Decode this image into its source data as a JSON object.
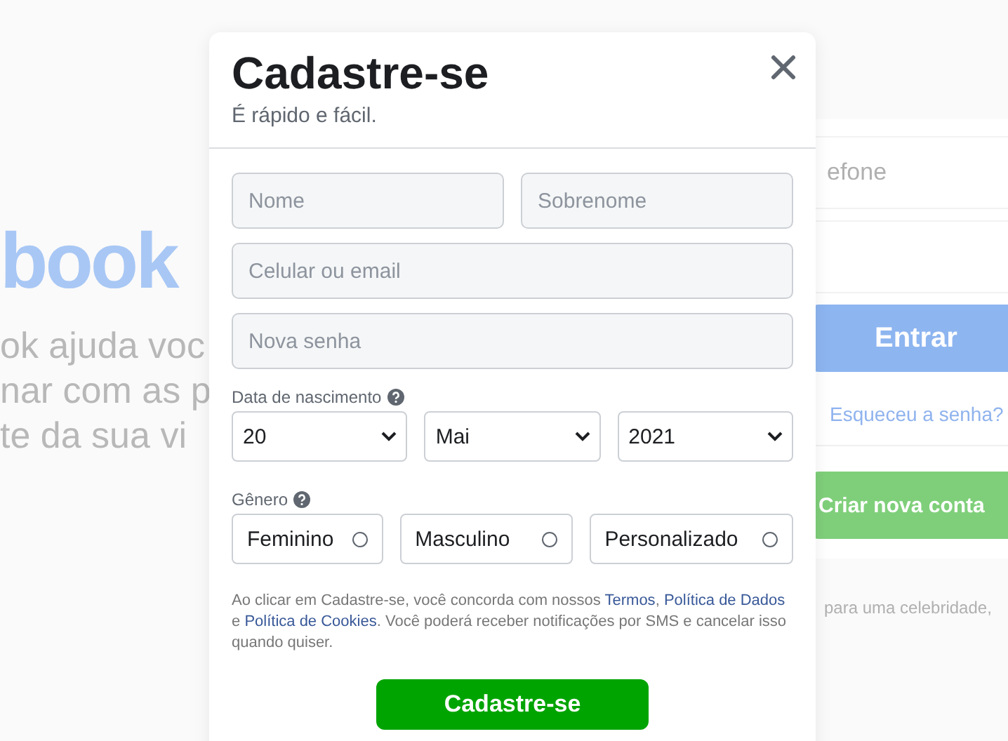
{
  "background": {
    "logo": "book",
    "tagline": [
      "ok ajuda voc",
      "nar com as p",
      "te da sua vi"
    ],
    "login": {
      "phone_placeholder": "efone",
      "login_button": "Entrar",
      "forgot_link": "Esqueceu a senha?",
      "create_button": "Criar nova conta",
      "footer": "para uma celebridade,"
    }
  },
  "dialog": {
    "title": "Cadastre-se",
    "subtitle": "É rápido e fácil.",
    "name_fields": [
      {
        "placeholder": "Nome"
      },
      {
        "placeholder": "Sobrenome"
      }
    ],
    "contact_field": {
      "placeholder": "Celular ou email"
    },
    "password_field": {
      "placeholder": "Nova senha"
    },
    "birth_label": "Data de nascimento",
    "birth_selects": [
      {
        "value": "20"
      },
      {
        "value": "Mai"
      },
      {
        "value": "2021"
      }
    ],
    "gender_label": "Gênero",
    "genders": [
      {
        "label": "Feminino",
        "selected": false
      },
      {
        "label": "Masculino",
        "selected": false
      },
      {
        "label": "Personalizado",
        "selected": false
      }
    ],
    "terms": [
      {
        "kind": "text",
        "text": "Ao clicar em Cadastre-se, você concorda com nossos "
      },
      {
        "kind": "link",
        "text": "Termos"
      },
      {
        "kind": "text",
        "text": ", "
      },
      {
        "kind": "link",
        "text": "Política de Dados"
      },
      {
        "kind": "text",
        "text": " e "
      },
      {
        "kind": "link",
        "text": "Política de Cookies"
      },
      {
        "kind": "text",
        "text": ". Você poderá receber notificações por SMS e cancelar isso quando quiser."
      }
    ],
    "submit_button": "Cadastre-se"
  }
}
